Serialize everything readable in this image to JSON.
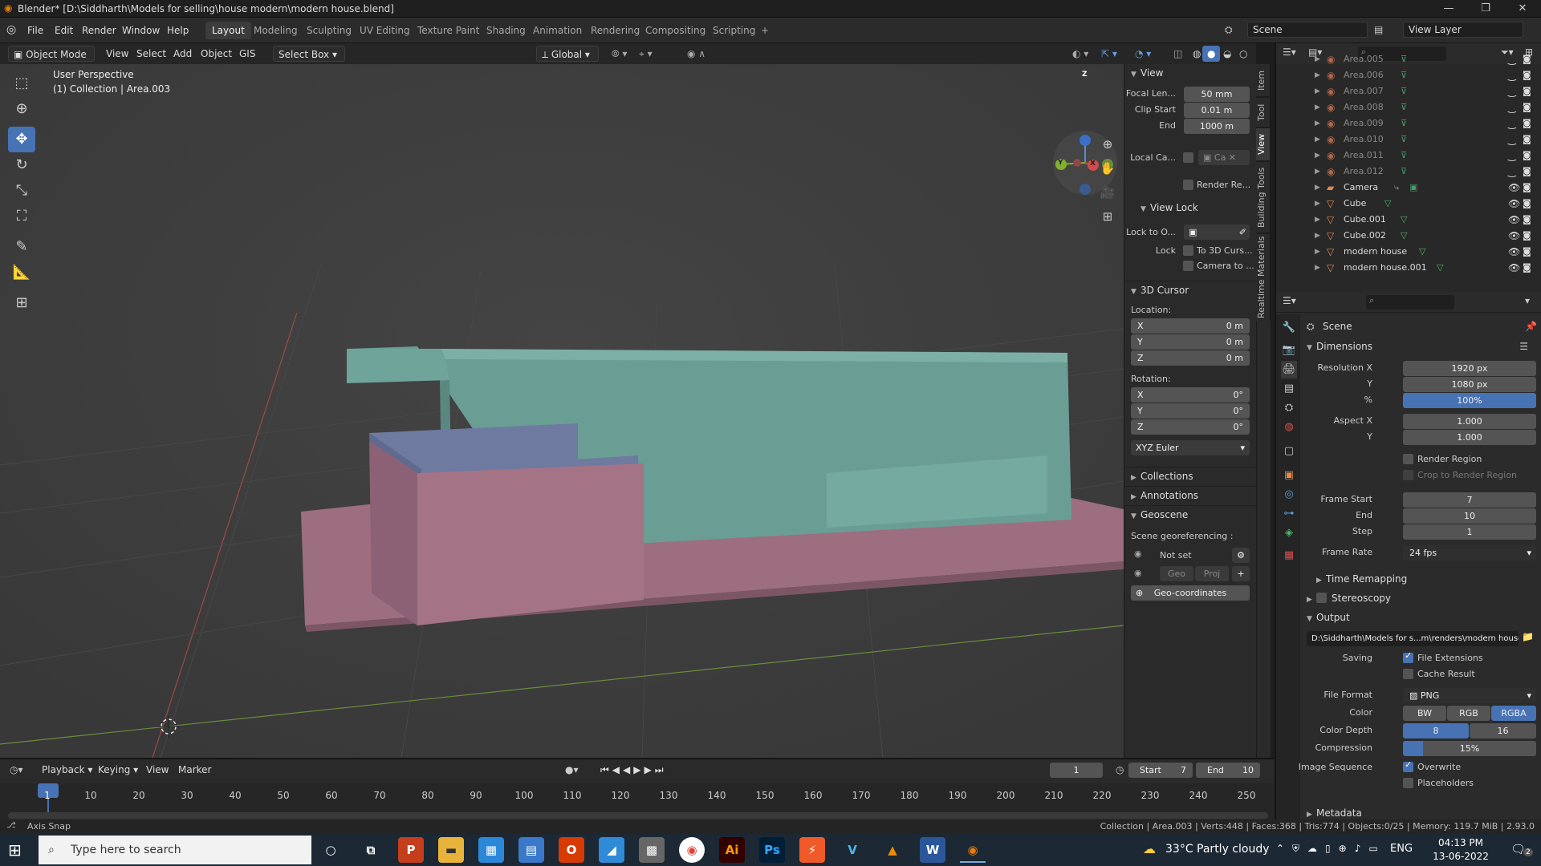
{
  "window": {
    "title": "Blender* [D:\\Siddharth\\Models for selling\\house modern\\modern house.blend]",
    "minimize": "—",
    "maximize": "❐",
    "close": "✕"
  },
  "menu": [
    "File",
    "Edit",
    "Render",
    "Window",
    "Help"
  ],
  "workspaces": [
    "Layout",
    "Modeling",
    "Sculpting",
    "UV Editing",
    "Texture Paint",
    "Shading",
    "Animation",
    "Rendering",
    "Compositing",
    "Scripting",
    "+"
  ],
  "scene": {
    "label": "Scene",
    "view_layer": "View Layer"
  },
  "viewport_header": {
    "mode": "Object Mode",
    "view": "View",
    "select": "Select",
    "add": "Add",
    "object": "Object",
    "gis": "GIS",
    "select_box": "Select Box",
    "transform": "Global"
  },
  "viewport": {
    "perspective": "User Perspective",
    "collection": "(1) Collection | Area.003",
    "gizmo": {
      "x": "X",
      "y": "Y",
      "z": "Z"
    }
  },
  "npanel": {
    "view_section": "View",
    "focal_label": "Focal Len...",
    "focal_value": "50 mm",
    "clip_start_label": "Clip Start",
    "clip_start_value": "0.01 m",
    "end_label": "End",
    "end_value": "1000 m",
    "local_camera_label": "Local Ca...",
    "local_camera_value": "Ca",
    "render_region_label": "Render Re...",
    "view_lock_section": "View Lock",
    "lock_to_object_label": "Lock to O...",
    "lock_label": "Lock",
    "to_3d_cursor": "To 3D Curs...",
    "camera_to": "Camera to ...",
    "cursor_section": "3D Cursor",
    "location_label": "Location:",
    "loc_x": "0 m",
    "loc_y": "0 m",
    "loc_z": "0 m",
    "rotation_label": "Rotation:",
    "rot_x": "0°",
    "rot_y": "0°",
    "rot_z": "0°",
    "axis_x": "X",
    "axis_y": "Y",
    "axis_z": "Z",
    "rotation_mode": "XYZ Euler",
    "collections_section": "Collections",
    "annotations_section": "Annotations",
    "geoscene_section": "Geoscene",
    "scene_georef": "Scene georeferencing :",
    "not_set": "Not set",
    "geo": "Geo",
    "proj": "Proj",
    "geo_coordinates": "Geo-coordinates"
  },
  "side_tabs": [
    "Item",
    "Tool",
    "View",
    "Building Tools",
    "Realtime Materials"
  ],
  "outliner": {
    "items": [
      {
        "name": "Area.005",
        "type": "light",
        "dim": true
      },
      {
        "name": "Area.006",
        "type": "light",
        "dim": true
      },
      {
        "name": "Area.007",
        "type": "light",
        "dim": true
      },
      {
        "name": "Area.008",
        "type": "light",
        "dim": true
      },
      {
        "name": "Area.009",
        "type": "light",
        "dim": true
      },
      {
        "name": "Area.010",
        "type": "light",
        "dim": true
      },
      {
        "name": "Area.011",
        "type": "light",
        "dim": true
      },
      {
        "name": "Area.012",
        "type": "light",
        "dim": true
      },
      {
        "name": "Camera",
        "type": "camera",
        "dim": false
      },
      {
        "name": "Cube",
        "type": "mesh",
        "dim": false
      },
      {
        "name": "Cube.001",
        "type": "mesh",
        "dim": false
      },
      {
        "name": "Cube.002",
        "type": "mesh",
        "dim": false
      },
      {
        "name": "modern house",
        "type": "mesh",
        "dim": false
      },
      {
        "name": "modern house.001",
        "type": "mesh",
        "dim": false
      }
    ]
  },
  "properties": {
    "breadcrumb": "Scene",
    "dimensions_section": "Dimensions",
    "resolution_x_label": "Resolution X",
    "resolution_x": "1920 px",
    "y_label": "Y",
    "resolution_y": "1080 px",
    "percent_label": "%",
    "percent": "100%",
    "aspect_x_label": "Aspect X",
    "aspect_x": "1.000",
    "aspect_y": "1.000",
    "render_region": "Render Region",
    "crop_region": "Crop to Render Region",
    "frame_start_label": "Frame Start",
    "frame_start": "7",
    "end_label": "End",
    "frame_end": "10",
    "step_label": "Step",
    "frame_step": "1",
    "frame_rate_label": "Frame Rate",
    "frame_rate": "24 fps",
    "time_remapping": "Time Remapping",
    "stereoscopy": "Stereoscopy",
    "output_section": "Output",
    "output_path": "D:\\Siddharth\\Models for s...m\\renders\\modern house",
    "saving_label": "Saving",
    "file_extensions": "File Extensions",
    "cache_result": "Cache Result",
    "file_format_label": "File Format",
    "file_format": "PNG",
    "color_label": "Color",
    "color_bw": "BW",
    "color_rgb": "RGB",
    "color_rgba": "RGBA",
    "color_depth_label": "Color Depth",
    "depth_8": "8",
    "depth_16": "16",
    "compression_label": "Compression",
    "compression": "15%",
    "image_sequence_label": "Image Sequence",
    "overwrite": "Overwrite",
    "placeholders": "Placeholders",
    "metadata": "Metadata"
  },
  "timeline": {
    "playback": "Playback",
    "keying": "Keying",
    "view": "View",
    "marker": "Marker",
    "current_frame": "1",
    "start_label": "Start",
    "start": "7",
    "end_label": "End",
    "end": "10",
    "ticks": [
      "1",
      "10",
      "20",
      "30",
      "40",
      "50",
      "60",
      "70",
      "80",
      "90",
      "100",
      "110",
      "120",
      "130",
      "140",
      "150",
      "160",
      "170",
      "180",
      "190",
      "200",
      "210",
      "220",
      "230",
      "240",
      "250"
    ]
  },
  "status": {
    "left": "Axis Snap",
    "right": "Collection | Area.003 | Verts:448 | Faces:368 | Tris:774 | Objects:0/25 | Memory: 119.7 MiB | 2.93.0"
  },
  "taskbar": {
    "search_placeholder": "Type here to search",
    "weather": "33°C  Partly cloudy",
    "lang": "ENG",
    "time": "04:13 PM",
    "date": "13-06-2022",
    "notif": "2"
  },
  "colors": {
    "accent": "#4772b3",
    "house_teal": "#6a9e94",
    "house_pink": "#a06e82",
    "house_blue": "#6e7aa0"
  }
}
